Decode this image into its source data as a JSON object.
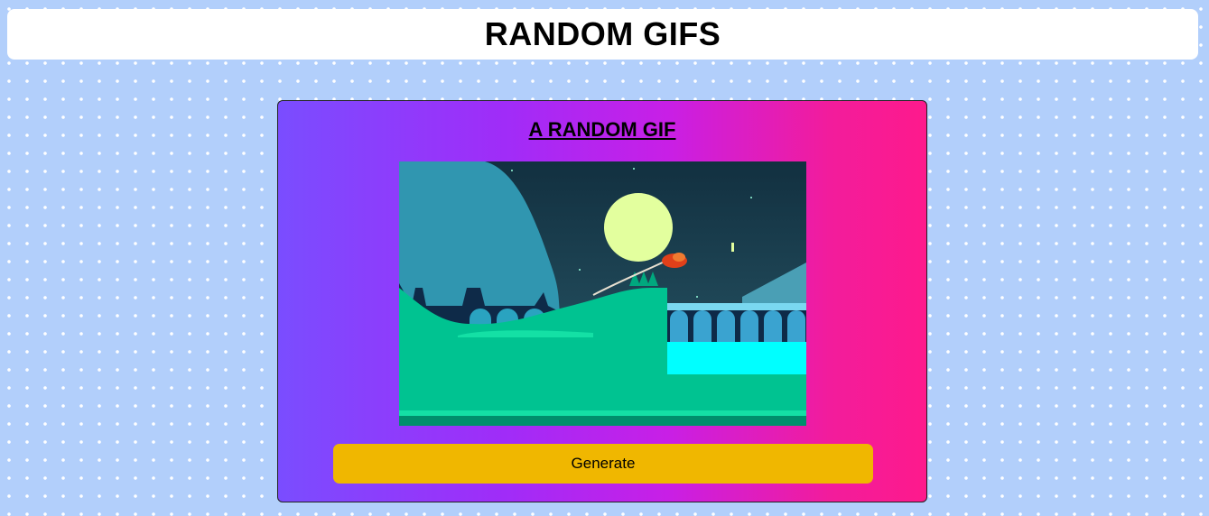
{
  "header": {
    "title": "RANDOM GIFS"
  },
  "card": {
    "title": "A RANDOM GIF",
    "gif_description": "animated scene",
    "generate_label": "Generate"
  },
  "colors": {
    "page_bg": "#b2cffb",
    "button": "#f0b700",
    "gradient_start": "#7a4dff",
    "gradient_end": "#fe1a8c"
  }
}
